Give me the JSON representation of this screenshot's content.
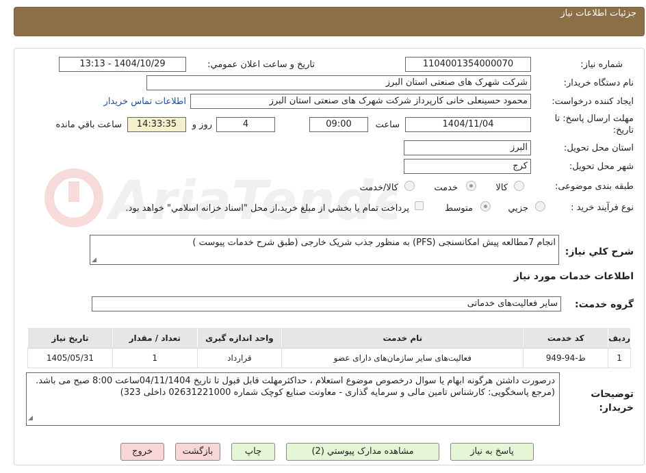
{
  "header": {
    "title": "جزئیات اطلاعات نیاز"
  },
  "fields": {
    "need_number_label": "شماره نیاز:",
    "need_number": "1104001354000070",
    "announce_label": "تاریخ و ساعت اعلان عمومي:",
    "announce_value": "1404/10/29 - 13:13",
    "device_label": "نام دستگاه خريدار:",
    "device_value": "شرکت شهرک های صنعتی استان البرز",
    "creator_label": "ايجاد كننده درخواست:",
    "creator_value": "محمود حسینعلی خانی کارپرداز شرکت شهرک های صنعتی استان البرز",
    "contact_link": "اطلاعات تماس خريدار",
    "deadline_label": "مهلت ارسال پاسخ: تا تاريخ:",
    "deadline_date": "1404/11/04",
    "time_label": "ساعت",
    "deadline_time": "09:00",
    "days": "4",
    "days_label": "روز و",
    "remaining": "14:33:35",
    "remaining_label": "ساعت باقي مانده",
    "province_label": "استان محل تحويل:",
    "province_value": "البرز",
    "city_label": "شهر محل تحويل:",
    "city_value": "کرج",
    "category_label": "طبقه بندی موضوعی:",
    "category_options": [
      "کالا",
      "خدمت",
      "کالا/خدمت"
    ],
    "category_selected": "خدمت",
    "process_label": "نوع فرآيند خريد :",
    "process_options": [
      "جزيي",
      "متوسط"
    ],
    "process_selected": "متوسط",
    "payment_note": "پرداخت تمام يا بخشي از مبلغ خريد،از محل \"اسناد خزانه اسلامي\" خواهد بود."
  },
  "summary": {
    "label": "شرح کلي نياز:",
    "text": "انجام  7مطالعه  پیش امکانسنجی (PFS) به منظور جذب شریک خارجی (طبق شرح خدمات پیوست )"
  },
  "services": {
    "section_title": "اطلاعات خدمات مورد نياز",
    "group_label": "گروه خدمت:",
    "group_value": "سایر فعالیت‌های خدماتی"
  },
  "table": {
    "headers": [
      "رديف",
      "کد خدمت",
      "نام خدمت",
      "واحد اندازه گيری",
      "تعداد / مقدار",
      "تاريخ نياز"
    ],
    "rows": [
      [
        "1",
        "ط-94-949",
        "فعالیت‌های سایر سازمان‌های دارای عضو",
        "قرارداد",
        "1",
        "1405/05/31"
      ]
    ]
  },
  "buyer_notes": {
    "label": "توضيحات خريدار:",
    "text": "درصورت داشتن هرگونه ابهام یا سوال درخصوص موضوع استعلام ، حداکثرمهلت قابل قبول تا تاریخ 04/11/1404ساعت 8:00 صبح می باشد.(مرجع پاسخگویی: کارشناس تامین مالی و سرمایه گذاری - معاونت صنایع کوچک شماره 02631221000 داخلی 323)"
  },
  "buttons": {
    "reply": "پاسخ به نياز",
    "attachments": "مشاهده مدارک پيوستي (2)",
    "print": "چاپ",
    "back": "بازگشت",
    "exit": "خروج"
  },
  "watermark": {
    "text": "AriaTender.neT"
  }
}
